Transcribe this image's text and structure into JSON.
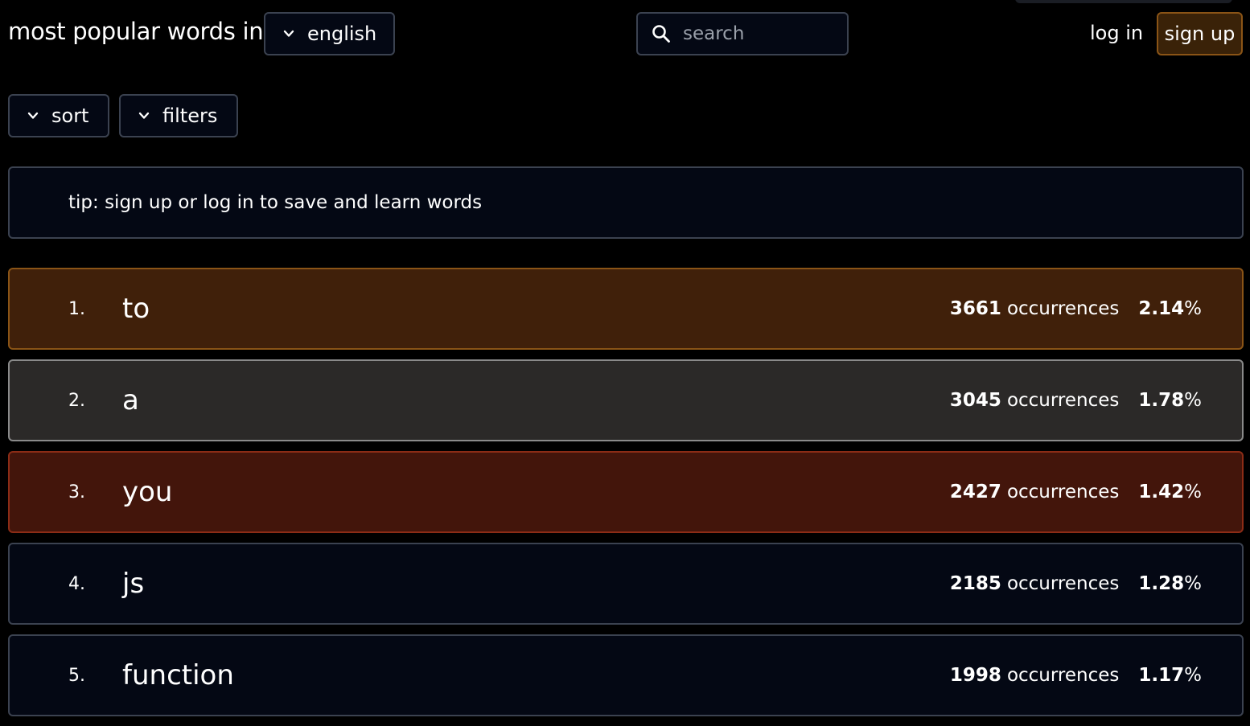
{
  "header": {
    "title": "most popular words in",
    "language": "english",
    "search_placeholder": "search",
    "login_label": "log in",
    "signup_label": "sign up"
  },
  "controls": {
    "sort_label": "sort",
    "filters_label": "filters"
  },
  "tip": "tip: sign up or log in to save and learn words",
  "colors": {
    "orange_row": "#40200a",
    "orange_border": "#8a5416",
    "gray_row": "#2b2928",
    "gray_border": "#8a8a8a",
    "red_row": "#43150b",
    "red_border": "#8c2c16",
    "dark_row": "#040814",
    "dark_border": "#3b4250"
  },
  "words": [
    {
      "rank": "1.",
      "word": "to",
      "count": "3661",
      "occ_label": "occurrences",
      "pct": "2.14",
      "pct_sign": "%",
      "theme": "orange"
    },
    {
      "rank": "2.",
      "word": "a",
      "count": "3045",
      "occ_label": "occurrences",
      "pct": "1.78",
      "pct_sign": "%",
      "theme": "gray"
    },
    {
      "rank": "3.",
      "word": "you",
      "count": "2427",
      "occ_label": "occurrences",
      "pct": "1.42",
      "pct_sign": "%",
      "theme": "red"
    },
    {
      "rank": "4.",
      "word": "js",
      "count": "2185",
      "occ_label": "occurrences",
      "pct": "1.28",
      "pct_sign": "%",
      "theme": "dark"
    },
    {
      "rank": "5.",
      "word": "function",
      "count": "1998",
      "occ_label": "occurrences",
      "pct": "1.17",
      "pct_sign": "%",
      "theme": "dark"
    }
  ]
}
